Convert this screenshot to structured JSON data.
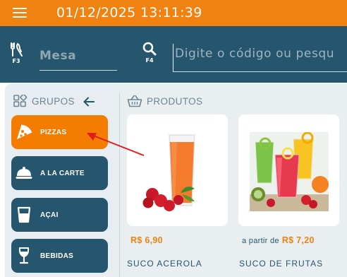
{
  "header": {
    "datetime": "01/12/2025 13:11:39",
    "menu_icon": "hamburger-icon"
  },
  "search": {
    "table_key": "F3",
    "table_placeholder": "Mesa",
    "code_key": "F4",
    "code_placeholder": "Digite o código ou pesqu"
  },
  "groups": {
    "title": "GRUPOS",
    "items": [
      {
        "label": "PIZZAS",
        "icon": "pizza-icon",
        "active": true
      },
      {
        "label": "A LA CARTE",
        "icon": "cloche-icon",
        "active": false
      },
      {
        "label": "AÇAI",
        "icon": "cup-icon",
        "active": false
      },
      {
        "label": "BEBIDAS",
        "icon": "wine-glass-icon",
        "active": false
      }
    ]
  },
  "products": {
    "title": "PRODUTOS",
    "items": [
      {
        "name": "SUCO ACEROLA",
        "price_prefix": "",
        "price": "R$ 6,90"
      },
      {
        "name": "SUCO DE FRUTAS",
        "price_prefix": "a partir de",
        "price": "R$ 7,20"
      }
    ]
  },
  "colors": {
    "accent": "#f08212",
    "primary": "#26566e",
    "background": "#e9eef1"
  }
}
